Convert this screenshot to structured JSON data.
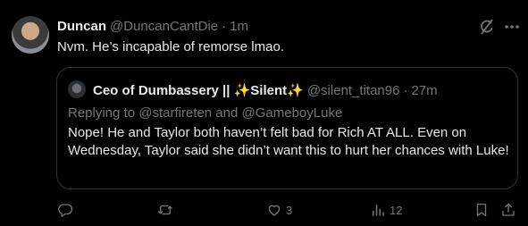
{
  "post": {
    "author_name": "Duncan",
    "author_handle": "@DuncanCantDie",
    "separator": "·",
    "time": "1m",
    "text": "Nvm. He’s incapable of remorse lmao."
  },
  "quote": {
    "name_prefix": "Ceo of Dumbassery || ",
    "spark1": "✨",
    "name_mid": "Silent",
    "spark2": "✨",
    "handle": "@silent_titan96",
    "separator": "·",
    "time": "27m",
    "replying_to": "Replying to @starfireten and @GameboyLuke",
    "text": "Nope! He and Taylor both haven’t felt bad for Rich AT ALL. Even on Wednesday, Taylor said she didn’t want this to hurt her chances with Luke!"
  },
  "actions": {
    "replies": "",
    "reposts": "",
    "likes": "3",
    "views": "12"
  },
  "icons": {
    "grok": "grok-icon",
    "more": "more-icon",
    "reply": "reply-icon",
    "repost": "repost-icon",
    "like": "heart-icon",
    "views": "views-icon",
    "bookmark": "bookmark-icon",
    "share": "share-icon"
  },
  "colors": {
    "background": "#000000",
    "text": "#e7e9ea",
    "muted": "#71767b",
    "border": "#2f3336",
    "sparkle": "#ffd23f"
  }
}
